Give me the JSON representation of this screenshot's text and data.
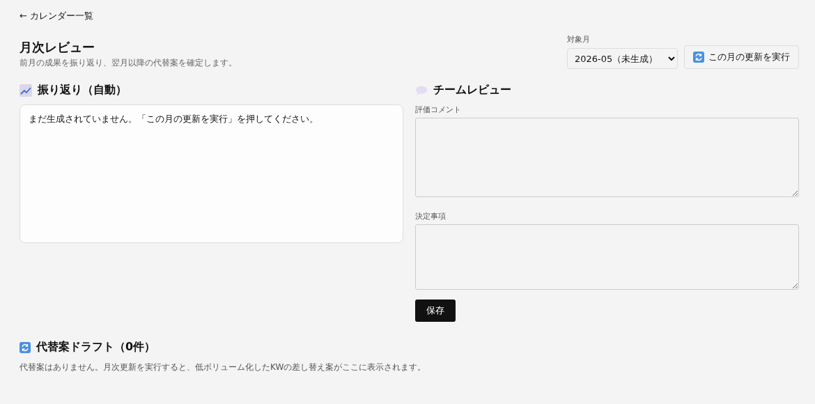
{
  "back_link": {
    "label": "← カレンダー一覧"
  },
  "header": {
    "title": "月次レビュー",
    "subtitle": "前月の成果を振り返り、翌月以降の代替案を確定します。"
  },
  "month_picker": {
    "label": "対象月",
    "value": "2026-05（未生成）"
  },
  "run_button": {
    "label": "この月の更新を実行"
  },
  "retrospective": {
    "title": "振り返り（自動）",
    "text": "まだ生成されていません。「この月の更新を実行」を押してください。"
  },
  "team_review": {
    "title": "チームレビュー",
    "fields": [
      {
        "label": "評価コメント"
      },
      {
        "label": "決定事項"
      }
    ],
    "save_button": {
      "label": "保存"
    }
  },
  "drafts": {
    "title": "代替案ドラフト（0件）",
    "empty_text": "代替案はありません。月次更新を実行すると、低ボリューム化したKWの差し替え案がここに表示されます。"
  }
}
